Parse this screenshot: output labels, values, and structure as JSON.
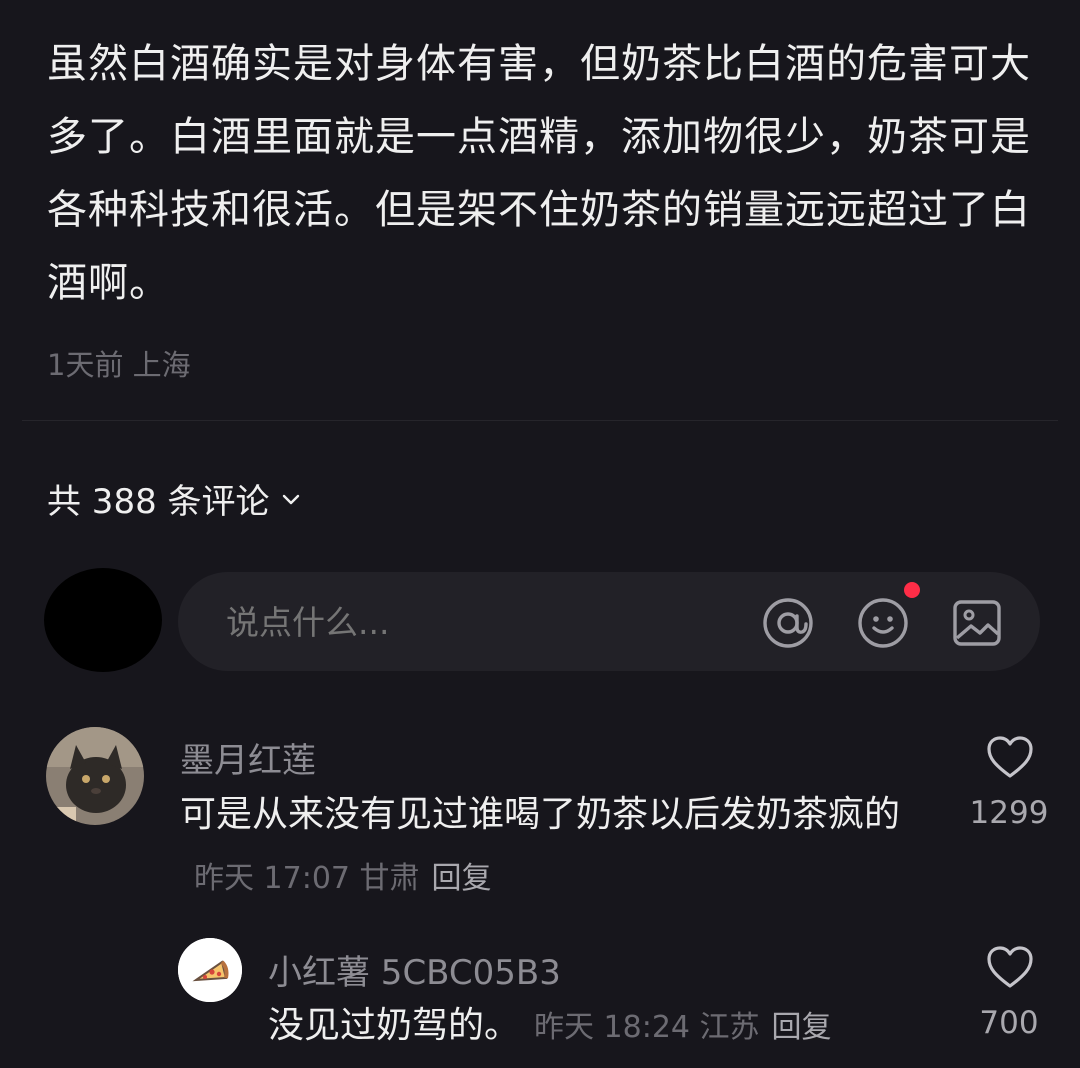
{
  "post": {
    "text": "虽然白酒确实是对身体有害，但奶茶比白酒的危害可大多了。白酒里面就是一点酒精，添加物很少，奶茶可是各种科技和很活。但是架不住奶茶的销量远远超过了白酒啊。",
    "meta": "1天前 上海"
  },
  "comments_header": {
    "count_label": "共 388 条评论"
  },
  "input": {
    "placeholder": "说点什么..."
  },
  "icons": {
    "input_actions": [
      "at-icon",
      "emoji-icon",
      "image-icon"
    ],
    "notification_dot_color": "#ff2d47"
  },
  "comments": [
    {
      "username": "墨月红莲",
      "text": "可是从来没有见过谁喝了奶茶以后发奶茶疯的",
      "time": "昨天 17:07 甘肃",
      "reply_label": "回复",
      "likes": "1299",
      "replies": [
        {
          "username": "小红薯 5CBC05B3",
          "text": "没见过奶驾的。",
          "time": "昨天 18:24 江苏",
          "reply_label": "回复",
          "likes": "700"
        }
      ]
    }
  ]
}
